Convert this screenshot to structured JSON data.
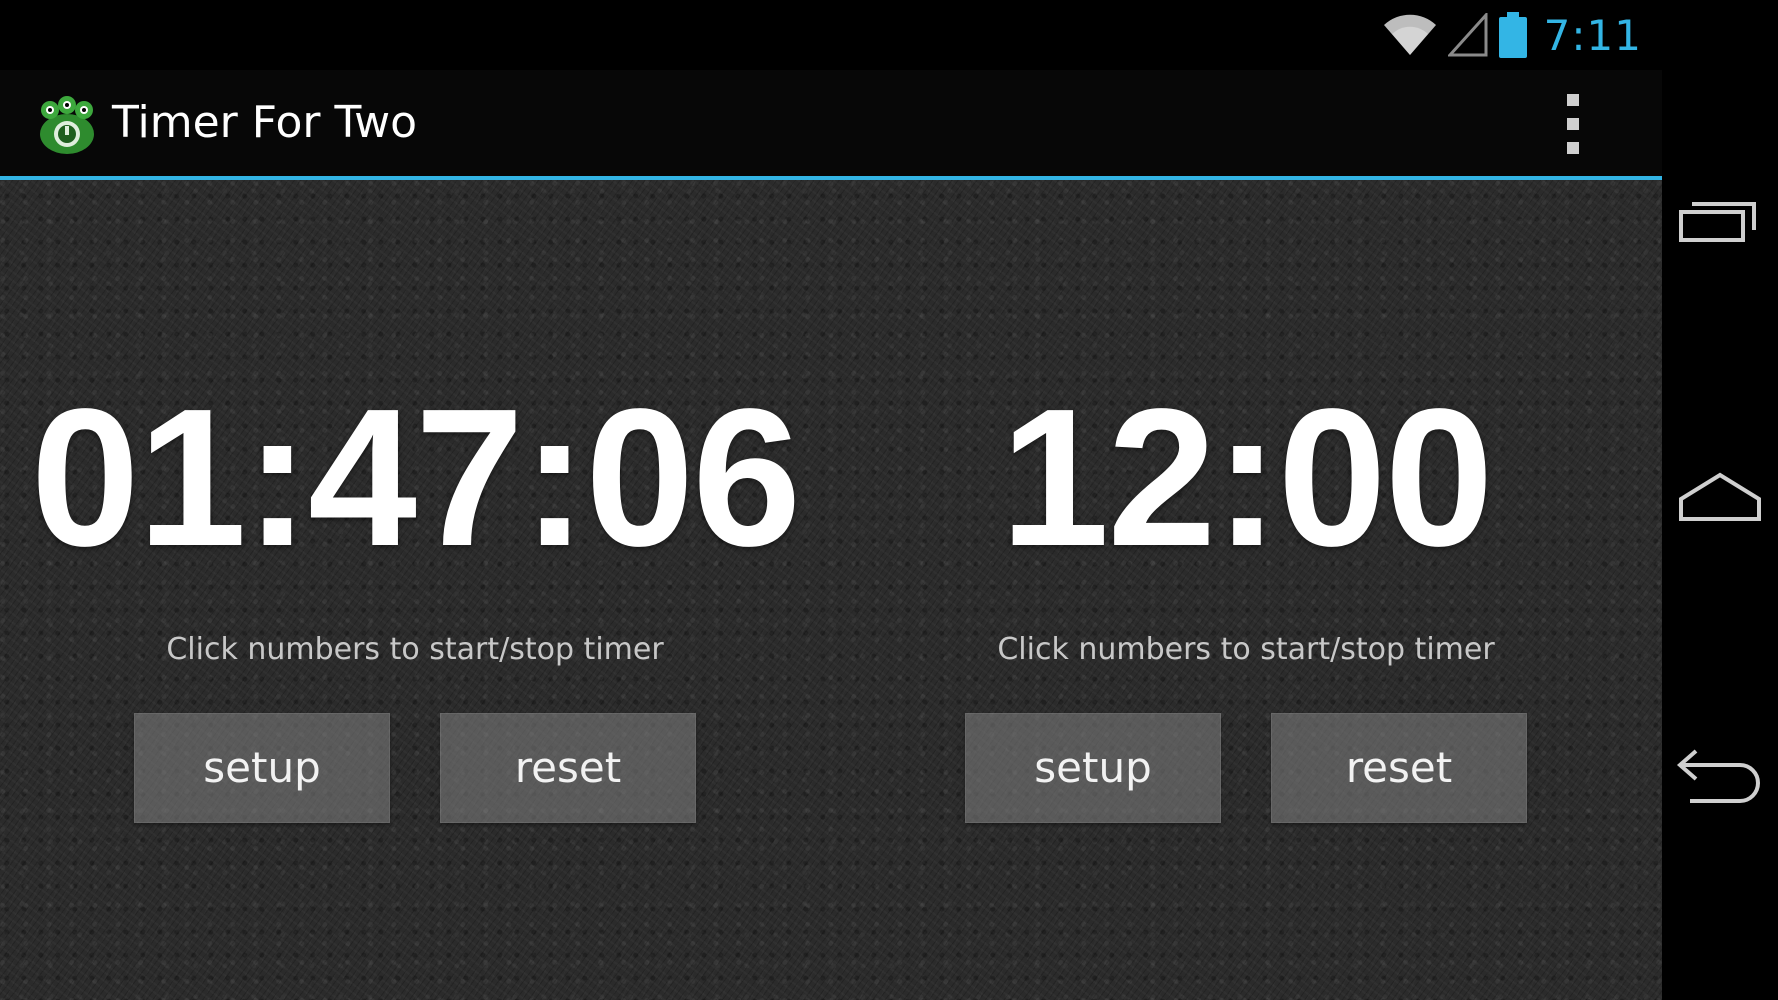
{
  "status_bar": {
    "time": "7:11",
    "icons": [
      "wifi-icon",
      "signal-icon",
      "battery-icon"
    ],
    "accent_color": "#33b5e5"
  },
  "action_bar": {
    "title": "Timer For Two",
    "app_icon": "frog-app-icon",
    "menu_icon": "overflow-menu-icon"
  },
  "timers": [
    {
      "display": "01:47:06",
      "hint": "Click numbers to start/stop timer",
      "setup_label": "setup",
      "reset_label": "reset"
    },
    {
      "display": "12:00",
      "hint": "Click numbers to start/stop timer",
      "setup_label": "setup",
      "reset_label": "reset"
    }
  ],
  "nav_bar": {
    "buttons": [
      "recent-apps-icon",
      "home-icon",
      "back-icon"
    ]
  },
  "colors": {
    "background": "#2b2b2b",
    "action_bar_underline": "#33b5e5",
    "timer_text": "#ffffff",
    "hint_text": "#c8c8c8"
  }
}
